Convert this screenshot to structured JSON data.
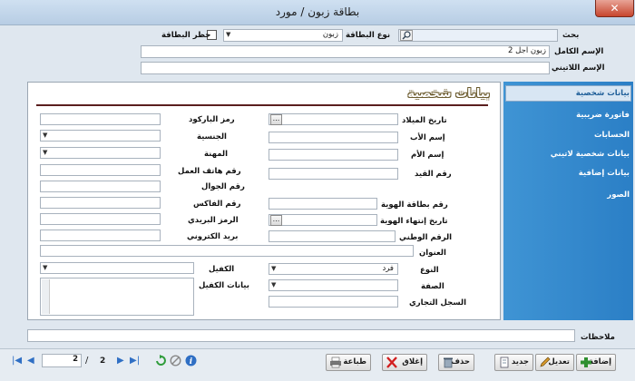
{
  "window": {
    "title": "بطاقة زبون / مورد",
    "close": "✕"
  },
  "top": {
    "search_label": "بحث",
    "card_type_label": "نوع البطاقة",
    "card_type_value": "زبون",
    "ban_card_label": "حظر البطاقة",
    "full_name_label": "الإسم الكامل",
    "full_name_value": "زبون اجل 2",
    "latin_name_label": "الإسم اللاتيني"
  },
  "section": {
    "heading": "بيانات شخصية"
  },
  "tabs": [
    "بيانات شخصية",
    "فاتورة ضريبية",
    "الحسابات",
    "بيانات شخصية لاتيني",
    "بيانات إضافية",
    "الصور"
  ],
  "form": {
    "dob": "تاريخ الميلاد",
    "father": "إسم الأب",
    "mother": "إسم الأم",
    "registry": "رقم القيد",
    "id_number": "رقم بطاقة الهوية",
    "id_expiry": "تاريخ إنتهاء الهوية",
    "national_no": "الرقم الوطني",
    "address": "العنوان",
    "gender": "النوع",
    "gender_value": "فرد",
    "capacity": "الصفة",
    "commercial_reg": "السجل التجاري",
    "barcode": "رمز الباركود",
    "nationality": "الجنسية",
    "profession": "المهنة",
    "work_phone": "رقم هاتف العمل",
    "mobile": "رقم الجوال",
    "fax": "رقم الفاكس",
    "postal": "الرمز البريدي",
    "email": "بريد الكتروني",
    "guarantor": "الكفيل",
    "guarantor_data": "بيانات الكفيل",
    "dots": "..."
  },
  "notes_label": "ملاحظات",
  "toolbar": {
    "add": "إضافة",
    "edit": "تعديل",
    "new": "جديد",
    "delete": "حذف",
    "close": "إغلاق",
    "print": "طباعة"
  },
  "pager": {
    "current": "2",
    "total": "2",
    "sep": "/"
  },
  "colors": {
    "tab_blue": "#2b7fc6",
    "heading_outline": "#6b5b2e"
  }
}
